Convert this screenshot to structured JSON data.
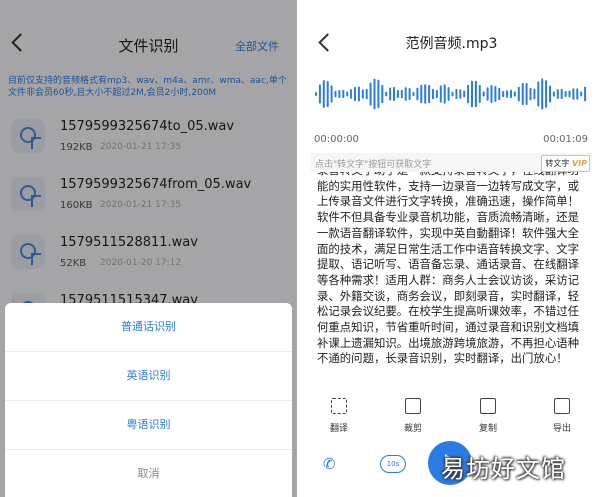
{
  "left": {
    "title": "文件识别",
    "all_files": "全部文件",
    "notice": "目前仅支持的音频格式有mp3、wav、m4a、amr、wma、aac,单个文件非会员60秒,且大小不超过2M,会员2小时,200M",
    "files": [
      {
        "name": "1579599325674to_05.wav",
        "size": "192KB",
        "date": "2020-01-21 17:35"
      },
      {
        "name": "1579599325674from_05.wav",
        "size": "160KB",
        "date": "2020-01-21 17:35"
      },
      {
        "name": "1579511528811.wav",
        "size": "52KB",
        "date": "2020-01-20 17:12"
      },
      {
        "name": "1579511515347.wav",
        "size": "",
        "date": ""
      }
    ],
    "sheet": {
      "options": [
        "普通话识别",
        "英语识别",
        "粤语识别"
      ],
      "cancel": "取消"
    }
  },
  "right": {
    "title": "范例音频.mp3",
    "time_start": "00:00:00",
    "time_end": "00:01:09",
    "hint": "点击\"转文字\"按钮可获取文字",
    "to_text": "转文字",
    "vip": "VIP",
    "text": "录音转文字助手是一款支持录音转文字，在线翻译功能的实用性软件，支持一边录音一边转写成文字，或上传录音文件进行文字转换，准确迅速，操作简单！软件不但具备专业录音机功能，音质流畅清晰，还是一款语音翻译软件，实现中英自動翻译！软件强大全面的技术，满足日常生活工作中语音转换文字、文字提取、语记听写、语音备忘录、通话录音、在线翻译等各种需求！适用人群：商务人士会议访谈，采访记录、外籍交谈，商务会议，即刻录音，实时翻译，轻松记录会议纪要。在校学生提高听课效率，不错过任何重点知识，节省重听时间，通过录音和识别文档填补课上遗漏知识。出境旅游跨境旅游，不再担心语种不通的问题，长录音识别，实时翻译，出门放心！",
    "tools": [
      "翻译",
      "裁剪",
      "复制",
      "导出"
    ],
    "rewind": "10s",
    "watermark": "易坊好文馆"
  }
}
